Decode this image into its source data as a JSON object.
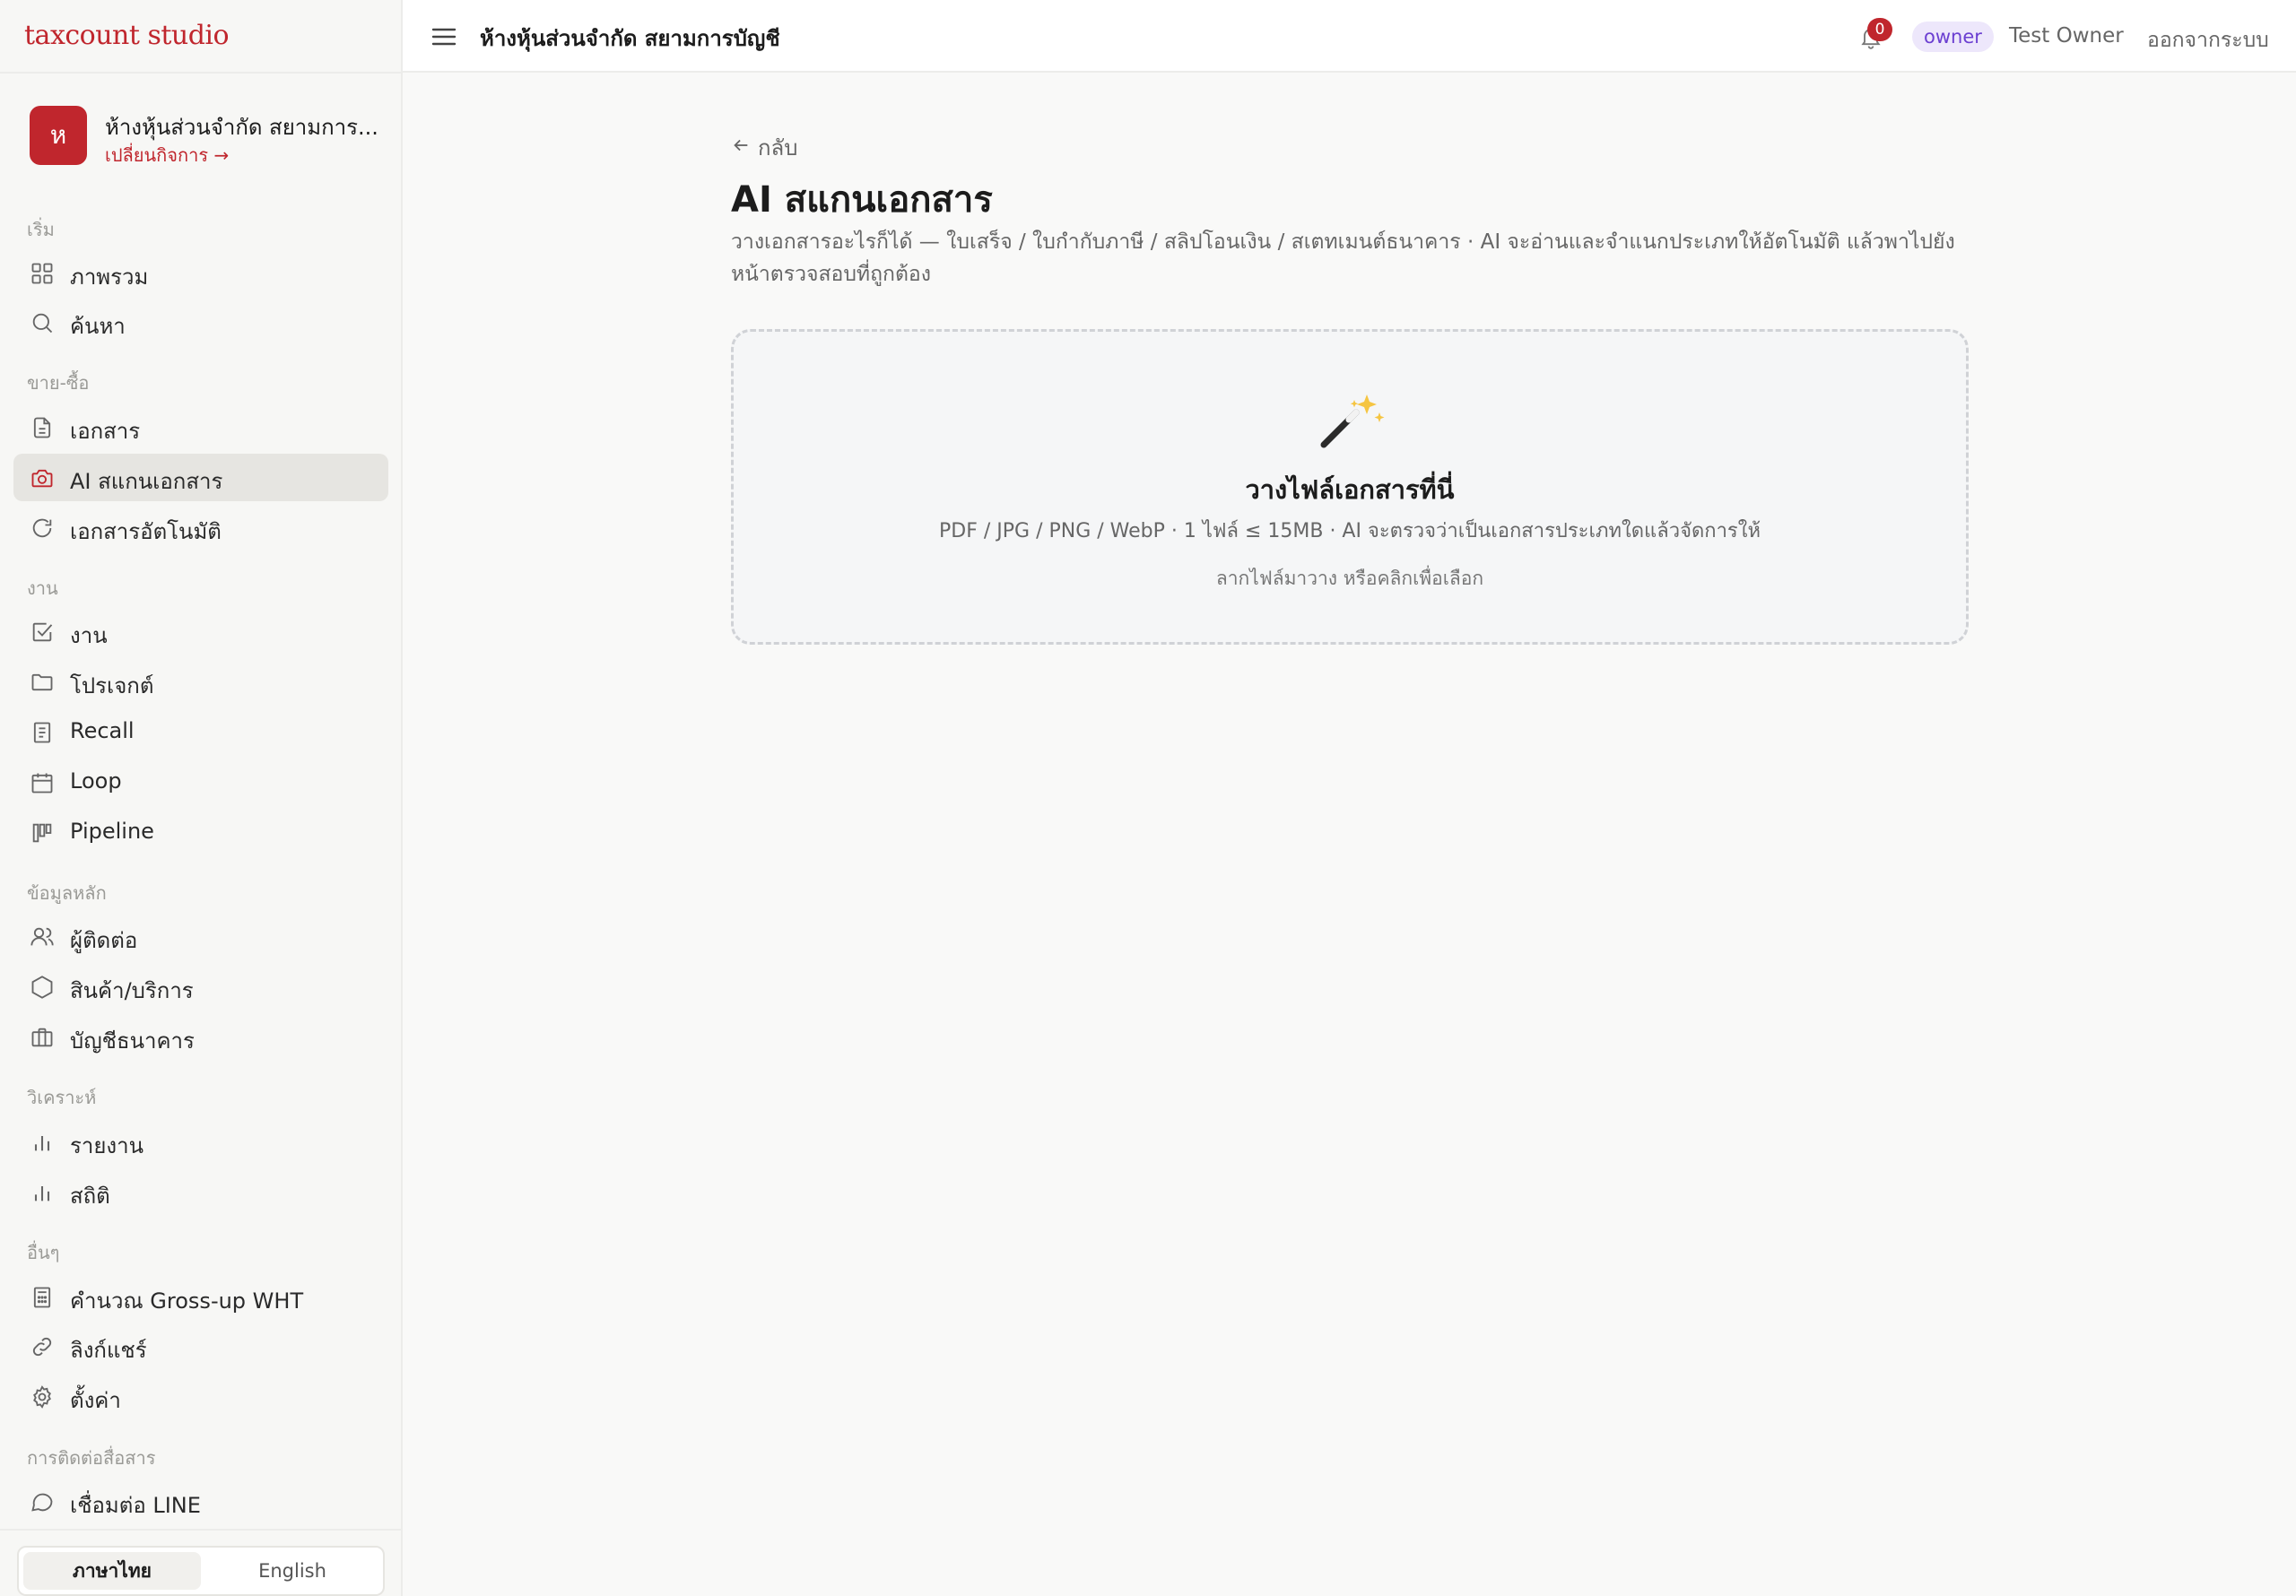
{
  "app": {
    "brand": "taxcount studio"
  },
  "business": {
    "avatar_letter": "ห",
    "name": "ห้างหุ้นส่วนจำกัด สยามการ...",
    "switch_label": "เปลี่ยนกิจการ →"
  },
  "sidebar": {
    "sections": {
      "start": "เริ่ม",
      "sales": "ขาย-ซื้อ",
      "work": "งาน",
      "master": "ข้อมูลหลัก",
      "analytics": "วิเคราะห์",
      "other": "อื่นๆ",
      "comm": "การติดต่อสื่อสาร"
    },
    "items": {
      "overview": "ภาพรวม",
      "search": "ค้นหา",
      "documents": "เอกสาร",
      "ai_scan": "AI สแกนเอกสาร",
      "auto_docs": "เอกสารอัตโนมัติ",
      "tasks": "งาน",
      "projects": "โปรเจกต์",
      "recall": "Recall",
      "loop": "Loop",
      "pipeline": "Pipeline",
      "contacts": "ผู้ติดต่อ",
      "products": "สินค้า/บริการ",
      "bank_accounts": "บัญชีธนาคาร",
      "reports": "รายงาน",
      "stats": "สถิติ",
      "grossup": "คำนวณ Gross-up WHT",
      "share_links": "ลิงก์แชร์",
      "settings": "ตั้งค่า",
      "line": "เชื่อมต่อ LINE"
    },
    "language": {
      "thai": "ภาษาไทย",
      "english": "English"
    }
  },
  "topbar": {
    "title": "ห้างหุ้นส่วนจำกัด สยามการบัญชี",
    "notification_count": "0",
    "role": "owner",
    "user": "Test Owner",
    "logout": "ออกจากระบบ"
  },
  "main": {
    "back": "กลับ",
    "title": "AI สแกนเอกสาร",
    "description": "วางเอกสารอะไรก็ได้ — ใบเสร็จ / ใบกำกับภาษี / สลิปโอนเงิน / สเตทเมนต์ธนาคาร · AI จะอ่านและจำแนกประเภทให้อัตโนมัติ แล้วพาไปยังหน้าตรวจสอบที่ถูกต้อง",
    "dropzone": {
      "icon": "magic-wand-icon",
      "title": "วางไฟล์เอกสารที่นี่",
      "types": "PDF / JPG / PNG / WebP · 1 ไฟล์ ≤ 15MB · AI จะตรวจว่าเป็นเอกสารประเภทใดแล้วจัดการให้",
      "hint": "ลากไฟล์มาวาง หรือคลิกเพื่อเลือก"
    }
  },
  "colors": {
    "accent": "#c0262d",
    "role_badge_text": "#6b3fd1",
    "role_badge_bg": "#ede7fb"
  }
}
